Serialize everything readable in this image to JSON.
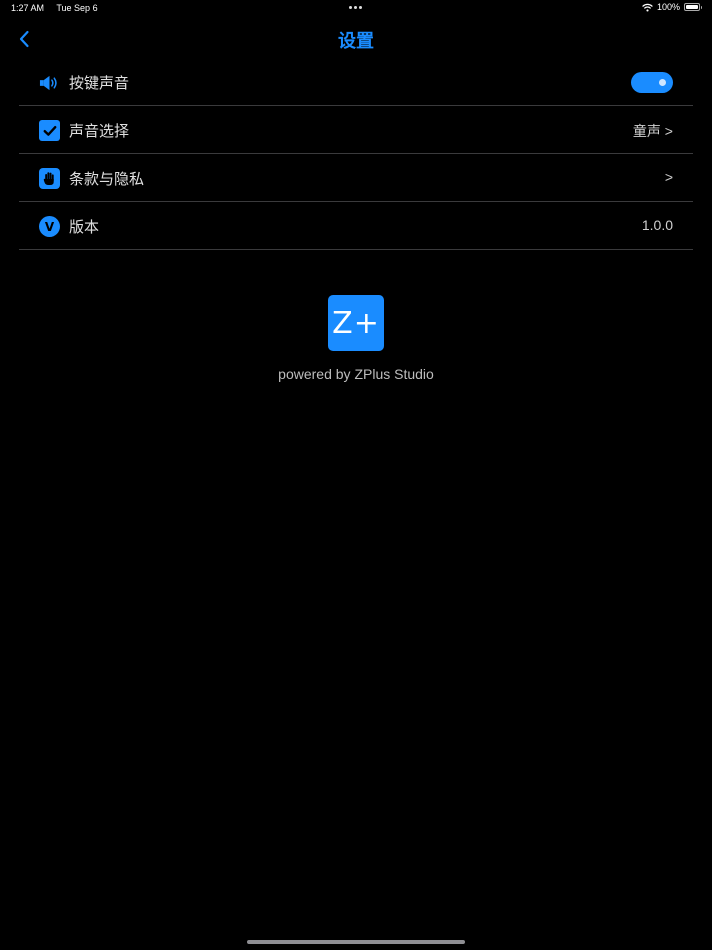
{
  "status_bar": {
    "time": "1:27 AM",
    "date": "Tue Sep 6",
    "battery": "100%"
  },
  "nav": {
    "title": "设置"
  },
  "settings": [
    {
      "label": "按键声音",
      "icon": "speaker-icon",
      "control": "toggle",
      "on": true
    },
    {
      "label": "声音选择",
      "icon": "checkbox-icon",
      "value": "童声 >"
    },
    {
      "label": "条款与隐私",
      "icon": "hand-icon",
      "value": ">"
    },
    {
      "label": "版本",
      "icon": "version-icon",
      "icon_text": "V",
      "value": "1.0.0"
    }
  ],
  "brand": {
    "logo_text": "Z+",
    "powered_by": "powered by ZPlus Studio"
  },
  "colors": {
    "accent": "#1a8cff",
    "background": "#000000",
    "separator": "#3a3a3c"
  }
}
